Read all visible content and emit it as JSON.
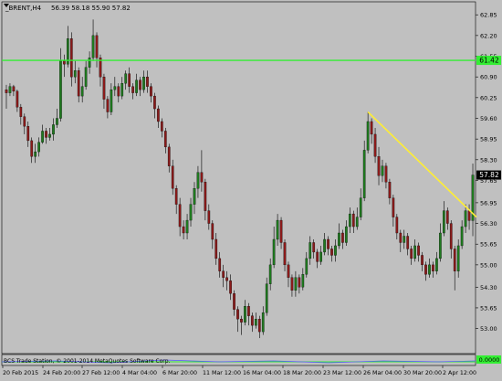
{
  "header": {
    "symbol": "_BRENT,H4",
    "ohlc": "56.39 58.18 55.90 57.82"
  },
  "colors": {
    "background": "#c0c0c0",
    "candle_up": "#1f7a1f",
    "candle_down": "#8b1a1a",
    "wick": "#000000",
    "hline": "#33ee33",
    "trendline": "#ffee33",
    "price_tag": "#000000"
  },
  "chart_data": {
    "type": "candlestick",
    "ylim": [
      52.3,
      63.2
    ],
    "y_ticks": [
      "62.85",
      "62.20",
      "61.55",
      "60.90",
      "60.25",
      "59.60",
      "58.95",
      "58.30",
      "57.65",
      "56.95",
      "56.30",
      "55.65",
      "55.00",
      "54.30",
      "53.65",
      "53.00"
    ],
    "x_ticks": [
      "20 Feb 2015",
      "24 Feb 20:00",
      "27 Feb 12:00",
      "4 Mar 04:00",
      "6 Mar 20:00",
      "11 Mar 12:00",
      "16 Mar 04:00",
      "18 Mar 20:00",
      "23 Mar 12:00",
      "26 Mar 04:00",
      "30 Mar 20:00",
      "2 Apr 12:00"
    ],
    "hline": {
      "value": 61.42,
      "label": "61.42"
    },
    "current_price": {
      "value": 57.82,
      "label": "57.82"
    },
    "trendline": {
      "start": [
        100,
        59.8
      ],
      "end": [
        130,
        56.5
      ]
    },
    "candles": [
      [
        60.5,
        60.4,
        60.65,
        59.9
      ],
      [
        60.4,
        60.6,
        60.7,
        60.3
      ],
      [
        60.6,
        60.45,
        60.65,
        60.3
      ],
      [
        60.45,
        59.95,
        60.5,
        59.8
      ],
      [
        59.95,
        59.65,
        60.05,
        59.4
      ],
      [
        59.65,
        59.35,
        59.75,
        59.1
      ],
      [
        59.35,
        58.9,
        59.5,
        58.7
      ],
      [
        58.9,
        58.4,
        59.0,
        58.2
      ],
      [
        58.4,
        58.55,
        58.8,
        58.2
      ],
      [
        58.55,
        58.85,
        59.0,
        58.4
      ],
      [
        58.85,
        59.2,
        59.4,
        58.8
      ],
      [
        59.2,
        59.0,
        59.3,
        58.8
      ],
      [
        59.0,
        59.1,
        59.3,
        58.9
      ],
      [
        59.1,
        59.4,
        59.6,
        58.9
      ],
      [
        59.4,
        59.6,
        59.9,
        59.3
      ],
      [
        59.6,
        61.4,
        61.8,
        59.5
      ],
      [
        61.4,
        61.3,
        61.6,
        60.9
      ],
      [
        61.3,
        62.1,
        62.5,
        61.2
      ],
      [
        62.1,
        60.9,
        62.3,
        60.6
      ],
      [
        60.9,
        61.1,
        61.4,
        60.7
      ],
      [
        61.1,
        60.3,
        61.2,
        60.1
      ],
      [
        60.3,
        60.6,
        60.9,
        60.1
      ],
      [
        60.6,
        61.2,
        61.4,
        60.5
      ],
      [
        61.2,
        61.5,
        61.7,
        61.0
      ],
      [
        61.5,
        62.2,
        62.7,
        61.4
      ],
      [
        62.2,
        61.5,
        62.3,
        61.2
      ],
      [
        61.5,
        60.9,
        61.6,
        60.6
      ],
      [
        60.9,
        60.2,
        61.0,
        59.9
      ],
      [
        60.2,
        59.8,
        60.3,
        59.6
      ],
      [
        59.8,
        60.5,
        60.7,
        59.7
      ],
      [
        60.5,
        60.6,
        60.9,
        60.3
      ],
      [
        60.6,
        60.3,
        60.7,
        60.1
      ],
      [
        60.3,
        60.7,
        60.9,
        60.2
      ],
      [
        60.7,
        61.0,
        61.1,
        60.5
      ],
      [
        61.0,
        60.6,
        61.2,
        60.4
      ],
      [
        60.6,
        60.4,
        60.7,
        60.2
      ],
      [
        60.4,
        60.8,
        61.0,
        60.3
      ],
      [
        60.8,
        60.5,
        60.9,
        60.3
      ],
      [
        60.5,
        60.9,
        61.1,
        60.4
      ],
      [
        60.9,
        60.6,
        61.1,
        60.4
      ],
      [
        60.6,
        60.3,
        60.7,
        60.1
      ],
      [
        60.3,
        59.9,
        60.4,
        59.6
      ],
      [
        59.9,
        59.5,
        60.0,
        59.3
      ],
      [
        59.5,
        59.2,
        59.6,
        59.0
      ],
      [
        59.2,
        58.7,
        59.3,
        58.5
      ],
      [
        58.7,
        58.1,
        58.8,
        57.9
      ],
      [
        58.1,
        57.4,
        58.3,
        57.2
      ],
      [
        57.4,
        56.9,
        57.5,
        56.6
      ],
      [
        56.9,
        56.2,
        57.1,
        55.9
      ],
      [
        56.2,
        56.0,
        56.4,
        55.8
      ],
      [
        56.0,
        56.4,
        56.6,
        55.8
      ],
      [
        56.4,
        56.9,
        57.1,
        56.2
      ],
      [
        56.9,
        57.4,
        57.6,
        56.6
      ],
      [
        57.4,
        57.9,
        58.1,
        57.1
      ],
      [
        57.9,
        57.6,
        58.6,
        57.3
      ],
      [
        57.6,
        56.7,
        57.7,
        56.4
      ],
      [
        56.7,
        56.3,
        56.9,
        56.1
      ],
      [
        56.3,
        55.8,
        56.4,
        55.5
      ],
      [
        55.8,
        55.2,
        56.0,
        55.0
      ],
      [
        55.2,
        54.8,
        55.4,
        54.6
      ],
      [
        54.8,
        54.6,
        55.0,
        54.3
      ],
      [
        54.6,
        54.5,
        54.8,
        54.2
      ],
      [
        54.5,
        54.1,
        54.7,
        53.9
      ],
      [
        54.1,
        53.6,
        54.2,
        53.4
      ],
      [
        53.6,
        53.3,
        53.7,
        52.9
      ],
      [
        53.3,
        53.2,
        53.4,
        52.8
      ],
      [
        53.2,
        53.7,
        53.9,
        53.1
      ],
      [
        53.7,
        53.4,
        53.8,
        53.1
      ],
      [
        53.4,
        53.1,
        53.5,
        52.9
      ],
      [
        53.1,
        53.3,
        53.5,
        53.0
      ],
      [
        53.3,
        52.9,
        53.4,
        52.7
      ],
      [
        52.9,
        53.5,
        53.7,
        52.8
      ],
      [
        53.5,
        54.4,
        54.6,
        53.4
      ],
      [
        54.4,
        55.0,
        55.2,
        54.2
      ],
      [
        55.0,
        55.8,
        56.2,
        54.9
      ],
      [
        55.8,
        56.4,
        56.6,
        55.6
      ],
      [
        56.4,
        55.7,
        56.5,
        55.5
      ],
      [
        55.7,
        55.0,
        55.8,
        54.8
      ],
      [
        55.0,
        54.6,
        55.1,
        54.3
      ],
      [
        54.6,
        54.2,
        54.7,
        54.0
      ],
      [
        54.2,
        54.6,
        54.8,
        54.0
      ],
      [
        54.6,
        54.3,
        54.7,
        54.1
      ],
      [
        54.3,
        54.7,
        54.9,
        54.2
      ],
      [
        54.7,
        55.2,
        55.4,
        54.6
      ],
      [
        55.2,
        55.7,
        55.9,
        55.0
      ],
      [
        55.7,
        55.4,
        55.8,
        55.2
      ],
      [
        55.4,
        55.1,
        55.5,
        54.9
      ],
      [
        55.1,
        55.4,
        55.6,
        55.0
      ],
      [
        55.4,
        55.8,
        56.0,
        55.3
      ],
      [
        55.8,
        55.5,
        55.9,
        55.3
      ],
      [
        55.5,
        55.3,
        55.6,
        55.1
      ],
      [
        55.3,
        55.6,
        55.8,
        55.1
      ],
      [
        55.6,
        56.0,
        56.3,
        55.5
      ],
      [
        56.0,
        55.7,
        56.1,
        55.5
      ],
      [
        55.7,
        56.2,
        56.4,
        55.6
      ],
      [
        56.2,
        56.6,
        56.8,
        56.0
      ],
      [
        56.6,
        56.2,
        56.7,
        56.0
      ],
      [
        56.2,
        56.5,
        56.8,
        56.1
      ],
      [
        56.5,
        57.1,
        57.4,
        56.4
      ],
      [
        57.1,
        58.6,
        58.9,
        57.0
      ],
      [
        58.6,
        59.5,
        59.8,
        58.5
      ],
      [
        59.5,
        59.1,
        59.6,
        58.8
      ],
      [
        59.1,
        58.4,
        59.3,
        58.2
      ],
      [
        58.4,
        57.8,
        58.7,
        57.5
      ],
      [
        57.8,
        58.1,
        58.3,
        57.6
      ],
      [
        58.1,
        57.6,
        58.2,
        57.4
      ],
      [
        57.6,
        57.1,
        57.7,
        56.9
      ],
      [
        57.1,
        56.5,
        57.2,
        56.2
      ],
      [
        56.5,
        56.0,
        56.6,
        55.8
      ],
      [
        56.0,
        55.7,
        56.1,
        55.4
      ],
      [
        55.7,
        55.9,
        56.1,
        55.5
      ],
      [
        55.9,
        55.5,
        56.0,
        55.3
      ],
      [
        55.5,
        55.2,
        55.6,
        55.0
      ],
      [
        55.2,
        55.6,
        55.8,
        55.1
      ],
      [
        55.6,
        55.3,
        55.7,
        55.1
      ],
      [
        55.3,
        55.0,
        55.4,
        54.8
      ],
      [
        55.0,
        54.7,
        55.1,
        54.5
      ],
      [
        54.7,
        55.0,
        55.2,
        54.6
      ],
      [
        55.0,
        54.8,
        55.1,
        54.6
      ],
      [
        54.8,
        55.2,
        55.4,
        54.7
      ],
      [
        55.2,
        56.0,
        56.3,
        55.1
      ],
      [
        56.0,
        56.7,
        57.0,
        55.9
      ],
      [
        56.7,
        56.3,
        56.8,
        56.1
      ],
      [
        56.3,
        55.5,
        56.4,
        55.2
      ],
      [
        55.5,
        54.8,
        55.6,
        54.2
      ],
      [
        54.8,
        55.6,
        55.8,
        54.6
      ],
      [
        55.6,
        56.2,
        56.4,
        55.5
      ],
      [
        56.2,
        56.7,
        56.9,
        56.0
      ],
      [
        56.7,
        56.39,
        56.9,
        56.1
      ],
      [
        56.39,
        57.82,
        58.18,
        55.9
      ]
    ]
  },
  "footer": {
    "copyright": "BCS Trade Station, © 2001-2014 MetaQuotes Software Corp.",
    "indicator_value": "0.0000"
  }
}
